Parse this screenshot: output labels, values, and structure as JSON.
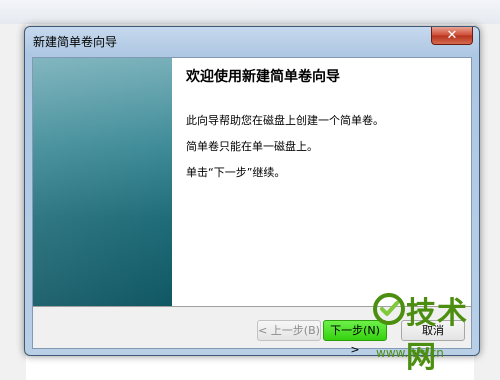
{
  "window": {
    "title": "新建简单卷向导",
    "close_glyph": "✕"
  },
  "wizard": {
    "heading": "欢迎使用新建简单卷向导",
    "paragraphs": [
      "此向导帮助您在磁盘上创建一个简单卷。",
      "简单卷只能在单一磁盘上。",
      "单击“下一步”继续。"
    ]
  },
  "buttons": {
    "back": "< 上一步(B)",
    "next": "下一步(N) >",
    "cancel": "取消"
  },
  "watermark": {
    "text": "技术网",
    "url": "www.itjs.cn"
  },
  "colors": {
    "accent_green": "#4c8f10",
    "side_panel": "#1f6c78",
    "close_red": "#cc4a33"
  }
}
